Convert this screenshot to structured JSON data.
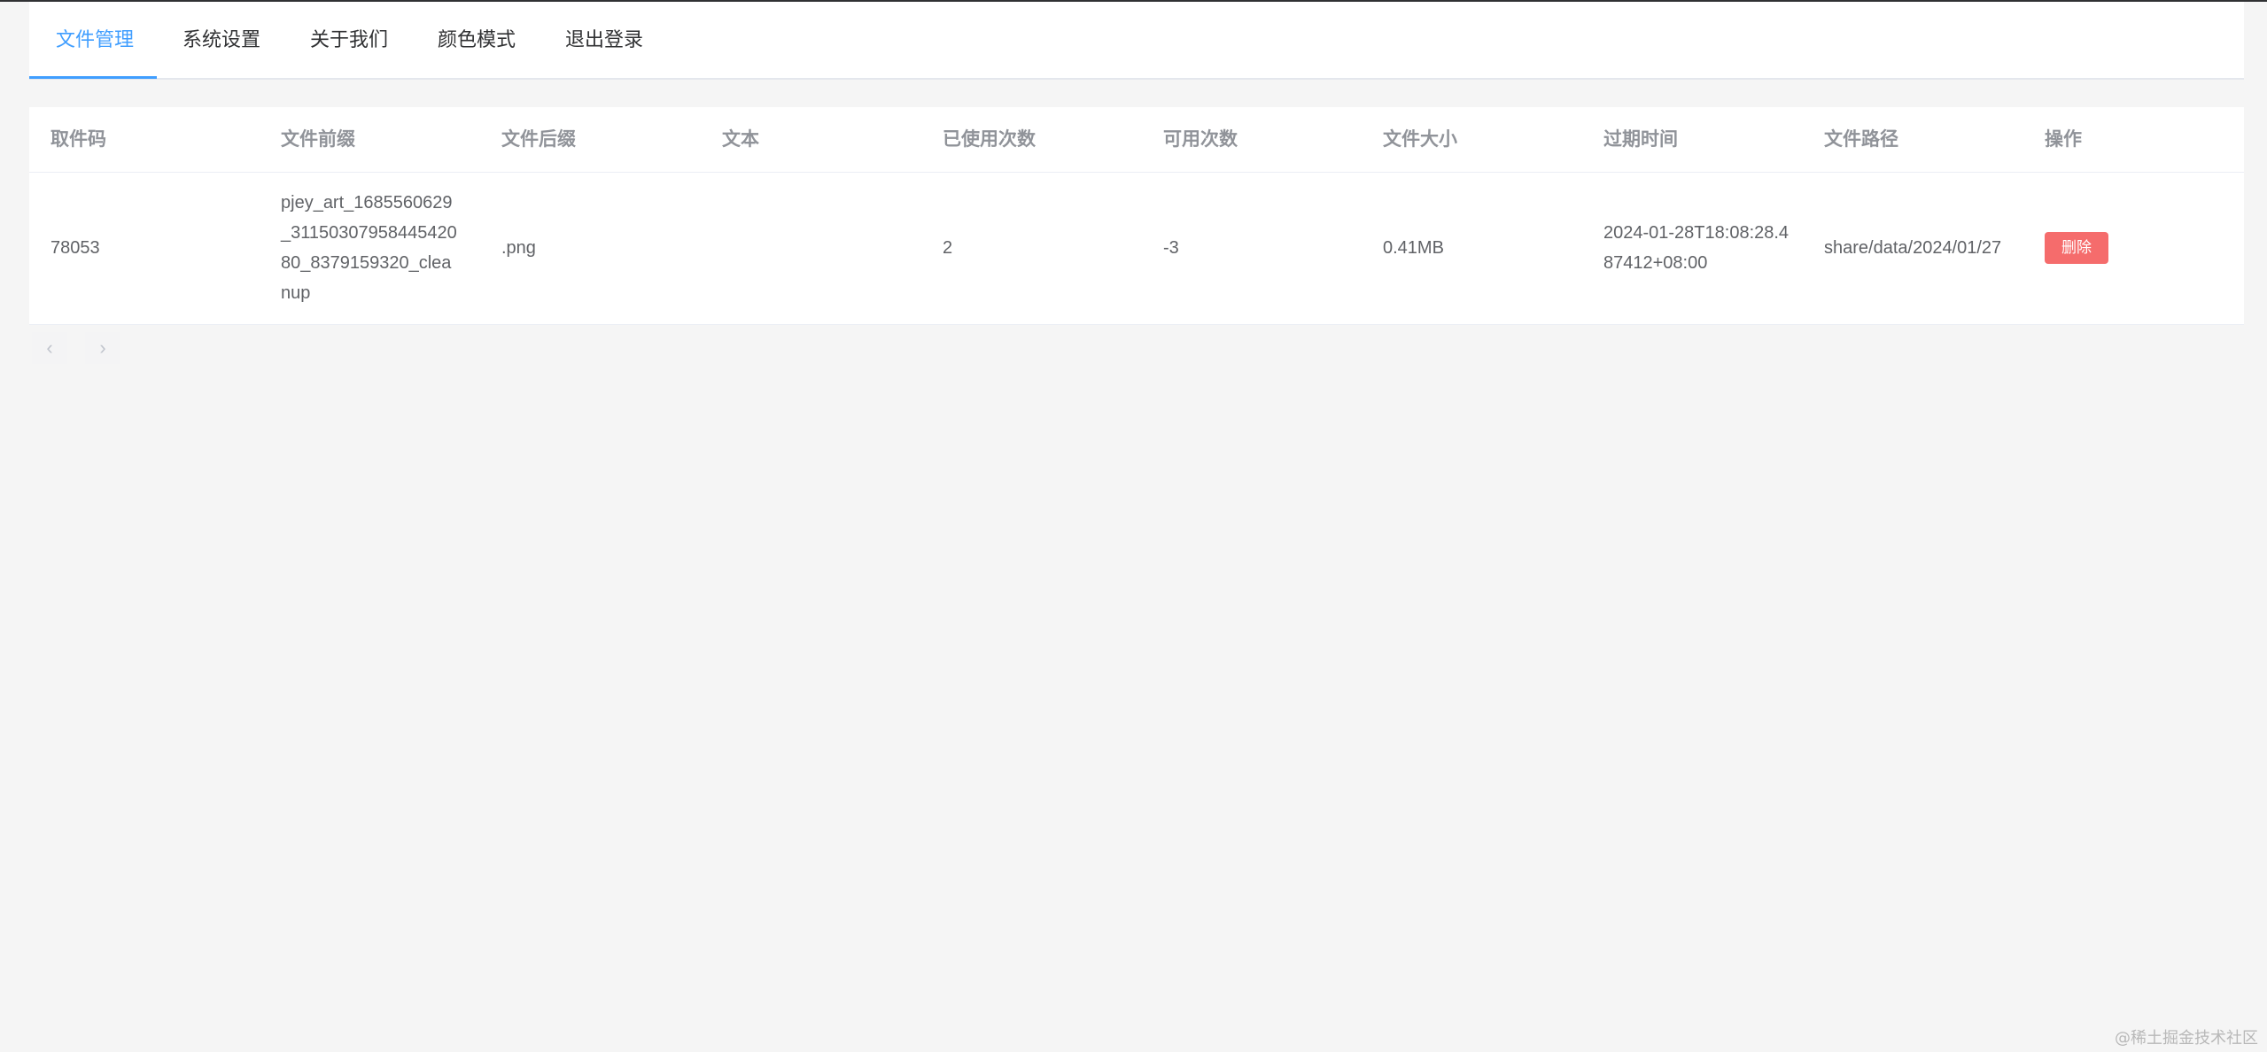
{
  "tabs": [
    {
      "label": "文件管理",
      "active": true
    },
    {
      "label": "系统设置",
      "active": false
    },
    {
      "label": "关于我们",
      "active": false
    },
    {
      "label": "颜色模式",
      "active": false
    },
    {
      "label": "退出登录",
      "active": false
    }
  ],
  "table": {
    "headers": [
      "取件码",
      "文件前缀",
      "文件后缀",
      "文本",
      "已使用次数",
      "可用次数",
      "文件大小",
      "过期时间",
      "文件路径",
      "操作"
    ],
    "rows": [
      {
        "code": "78053",
        "prefix": "pjey_art_1685560629_3115030795844542080_8379159320_cleanup",
        "suffix": ".png",
        "text": "",
        "used_count": "2",
        "available_count": "-3",
        "size": "0.41MB",
        "expire_time": "2024-01-28T18:08:28.487412+08:00",
        "path": "share/data/2024/01/27",
        "action_label": "删除"
      }
    ]
  },
  "pagination": {
    "prev_icon": "‹",
    "next_icon": "›"
  },
  "watermark": "@稀土掘金技术社区",
  "colors": {
    "accent": "#409eff",
    "danger": "#f56c6c",
    "background": "#f5f5f5"
  }
}
